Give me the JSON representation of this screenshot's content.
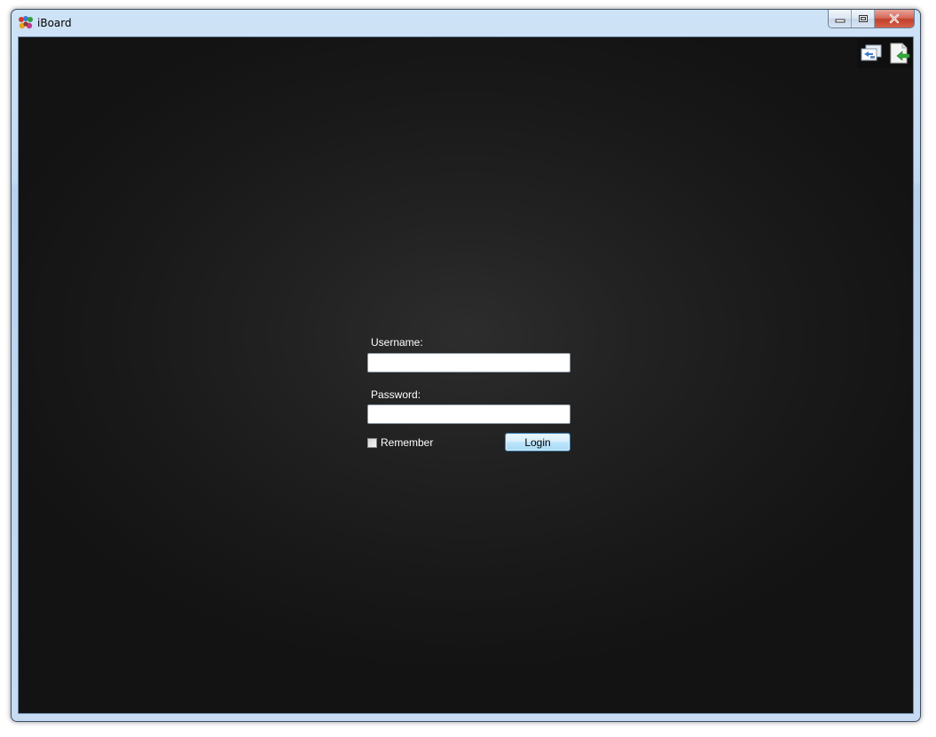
{
  "window": {
    "title": "iBoard"
  },
  "toolbar": {
    "icons": [
      "switch-board-icon",
      "logout-door-icon"
    ]
  },
  "login": {
    "username_label": "Username:",
    "username_value": "",
    "password_label": "Password:",
    "password_value": "",
    "remember_label": "Remember",
    "remember_checked": false,
    "login_button": "Login"
  },
  "colors": {
    "background": "#1a1a1a",
    "titlebar": "#c2daf3",
    "close_button": "#c2412c",
    "button_accent": "#3c7fb1"
  }
}
